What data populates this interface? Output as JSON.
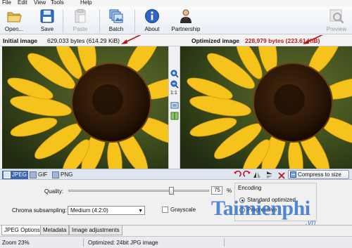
{
  "menu": [
    "File",
    "Edit",
    "View",
    "Tools",
    "Help"
  ],
  "toolbar": {
    "open": "Open...",
    "save": "Save",
    "paste": "Paste",
    "batch": "Batch",
    "about": "About",
    "partnership": "Partnership",
    "preview": "Preview"
  },
  "infobar": {
    "initial_label": "Initial image",
    "initial_size": "629,033 bytes (614.29 KiB)",
    "optimized_label": "Optimized image",
    "optimized_size": "228,979 bytes (223.61 KiB)"
  },
  "side_tools": {
    "ratio_label": "1:1"
  },
  "formats": [
    "JPEG",
    "GIF",
    "PNG"
  ],
  "compress_button": "Compress to size",
  "options": {
    "quality_label": "Quality:",
    "quality_value": "75",
    "quality_unit": "%",
    "quality_fraction": 0.74,
    "chroma_label": "Chroma subsampling:",
    "chroma_value": "Medium (4:2:0)",
    "grayscale_label": "Grayscale",
    "encoding_title": "Encoding",
    "encoding_options": [
      "Standard optimized",
      "Progressive"
    ]
  },
  "bottom_tabs": [
    "JPEG Options",
    "Metadata",
    "Image adjustments"
  ],
  "status": {
    "zoom": "Zoom 23%",
    "optimized_info": "Optimized: 24bit JPG image"
  },
  "watermark": {
    "brand": "Taimienphi",
    "suffix": ".vn"
  },
  "colors": {
    "accent_red": "#c0171c",
    "active_tab": "#3d67b0",
    "brand": "#2d6ec8"
  }
}
